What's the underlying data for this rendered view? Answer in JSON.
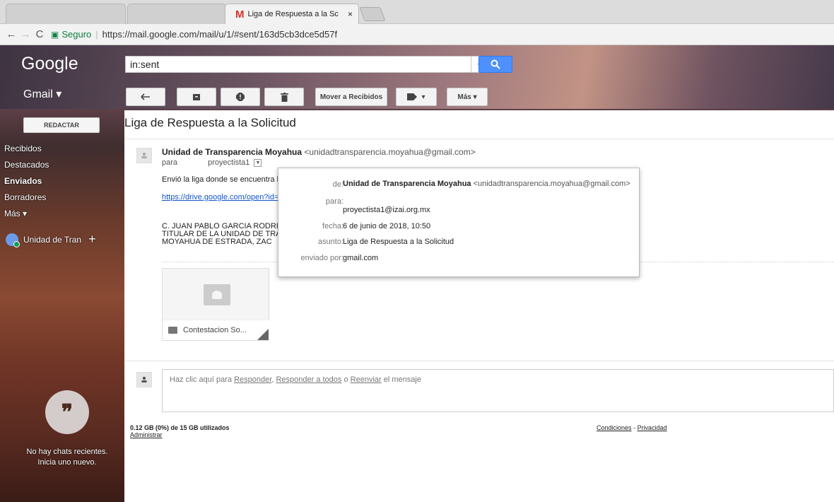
{
  "browser": {
    "tab_title": "Liga de Respuesta a la Sc",
    "tab_close": "×",
    "security_label": "Seguro",
    "url": "https://mail.google.com/mail/u/1/#sent/163d5cb3dce5d57f"
  },
  "header": {
    "logo": "Google",
    "search_query": "in:sent",
    "app_label": "Gmail ▾"
  },
  "toolbar": {
    "move_to_inbox": "Mover a Recibidos",
    "more": "Más ▾",
    "labels_caret": "▾"
  },
  "sidebar": {
    "compose": "REDACTAR",
    "items": [
      {
        "label": "Recibidos"
      },
      {
        "label": "Destacados"
      },
      {
        "label": "Enviados"
      },
      {
        "label": "Borradores"
      },
      {
        "label": "Más ▾"
      }
    ],
    "account_name": "Unidad de Tran",
    "account_add": "+",
    "hangouts_empty_line1": "No hay chats recientes.",
    "hangouts_empty_line2": "Inicia uno nuevo."
  },
  "message": {
    "subject": "Liga de Respuesta a la Solicitud",
    "sender_name": "Unidad de Transparencia Moyahua",
    "sender_email": "<unidadtransparencia.moyahua@gmail.com>",
    "to_prefix": "para",
    "to_name": "proyectista1",
    "body_line1": "Envió la liga donde se encuentra l",
    "body_link": "https://drive.google.com/open?id=",
    "signature_line1": "C. JUAN PABLO GARCIA RODRI",
    "signature_line2": "TITULAR DE LA UNIDAD DE TRA",
    "signature_line3": "MOYAHUA DE ESTRADA, ZAC",
    "attachment_name": "Contestacion So..."
  },
  "details_popup": {
    "from_label": "de:",
    "from_name": "Unidad de Transparencia Moyahua",
    "from_email": "<unidadtransparencia.moyahua@gmail.com>",
    "to_label": "para:",
    "to_value": "proyectista1@izai.org.mx",
    "date_label": "fecha:",
    "date_value": "6 de junio de 2018, 10:50",
    "subject_label": "asunto:",
    "subject_value": "Liga de Respuesta a la Solicitud",
    "sent_by_label": "enviado por:",
    "sent_by_value": "gmail.com"
  },
  "reply": {
    "prefix": "Haz clic aquí para",
    "reply": "Responder",
    "reply_all": "Responder a todos",
    "or": "o",
    "forward": "Reenviar",
    "suffix": "el mensaje"
  },
  "footer": {
    "storage": "0.12 GB (0%) de 15 GB utilizados",
    "manage": "Administrar",
    "terms": "Condiciones",
    "dash": "-",
    "privacy": "Privacidad"
  },
  "colors": {
    "accent_blue": "#4d90fe",
    "link": "#1155cc",
    "secure_green": "#0b8043"
  }
}
